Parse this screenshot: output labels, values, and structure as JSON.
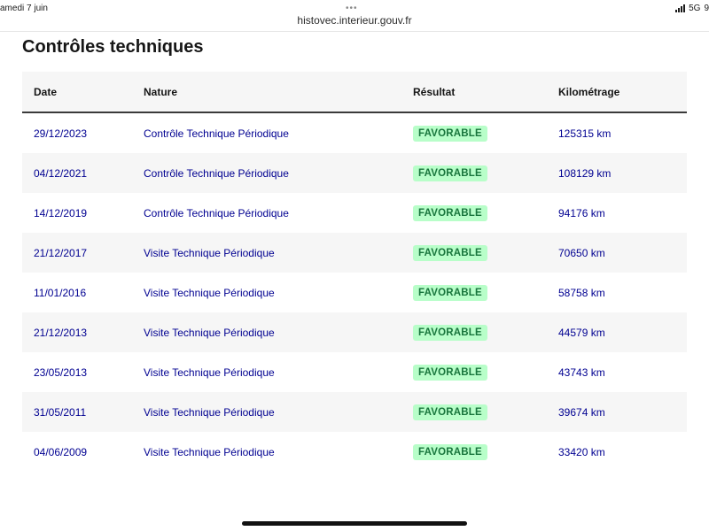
{
  "status_bar": {
    "date": "amedi 7 juin",
    "network": "5G",
    "battery_partial": "9"
  },
  "browser": {
    "url": "histovec.interieur.gouv.fr",
    "menu_icon": "more-dots-icon"
  },
  "page": {
    "title": "Contrôles techniques"
  },
  "table": {
    "headers": {
      "date": "Date",
      "nature": "Nature",
      "result": "Résultat",
      "mileage": "Kilométrage"
    },
    "rows": [
      {
        "date": "29/12/2023",
        "nature": "Contrôle Technique Périodique",
        "result": "FAVORABLE",
        "mileage": "125315 km"
      },
      {
        "date": "04/12/2021",
        "nature": "Contrôle Technique Périodique",
        "result": "FAVORABLE",
        "mileage": "108129 km"
      },
      {
        "date": "14/12/2019",
        "nature": "Contrôle Technique Périodique",
        "result": "FAVORABLE",
        "mileage": "94176 km"
      },
      {
        "date": "21/12/2017",
        "nature": "Visite Technique Périodique",
        "result": "FAVORABLE",
        "mileage": "70650 km"
      },
      {
        "date": "11/01/2016",
        "nature": "Visite Technique Périodique",
        "result": "FAVORABLE",
        "mileage": "58758 km"
      },
      {
        "date": "21/12/2013",
        "nature": "Visite Technique Périodique",
        "result": "FAVORABLE",
        "mileage": "44579 km"
      },
      {
        "date": "23/05/2013",
        "nature": "Visite Technique Périodique",
        "result": "FAVORABLE",
        "mileage": "43743 km"
      },
      {
        "date": "31/05/2011",
        "nature": "Visite Technique Périodique",
        "result": "FAVORABLE",
        "mileage": "39674 km"
      },
      {
        "date": "04/06/2009",
        "nature": "Visite Technique Périodique",
        "result": "FAVORABLE",
        "mileage": "33420 km"
      }
    ]
  },
  "colors": {
    "link_blue": "#000091",
    "badge_bg": "#b8fec9",
    "badge_text": "#18753c",
    "stripe": "#f6f6f6",
    "header_border": "#3a3a3a"
  }
}
